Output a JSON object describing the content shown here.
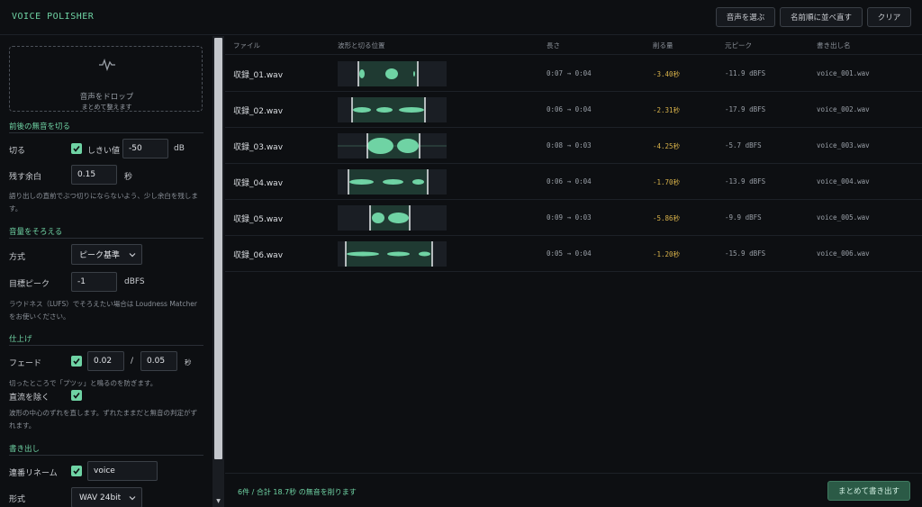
{
  "header": {
    "app_title": "VOICE POLISHER",
    "buttons": {
      "select_audio": "音声を選ぶ",
      "sort_rename": "名前順に並べ直す",
      "clear": "クリア"
    }
  },
  "sidebar": {
    "dropzone": {
      "main": "音声をドロップ",
      "sub": "まとめて整えます",
      "icon": "waveform-icon"
    },
    "trim": {
      "title": "前後の無音を切る",
      "cut_label": "切る",
      "threshold_checked": true,
      "threshold_label": "しきい値",
      "threshold_value": "-50",
      "threshold_unit": "dB",
      "margin_label": "残す余白",
      "margin_value": "0.15",
      "margin_unit": "秒",
      "help": "語り出しの直前でぶつ切りにならないよう、少し余白を残します。"
    },
    "volume": {
      "title": "音量をそろえる",
      "method_label": "方式",
      "method_value": "ピーク基準",
      "target_label": "目標ピーク",
      "target_value": "-1",
      "target_unit": "dBFS",
      "help": "ラウドネス（LUFS）でそろえたい場合は Loudness Matcher をお使いください。"
    },
    "finish": {
      "title": "仕上げ",
      "fade_label": "フェード",
      "fade_checked": true,
      "fade_in": "0.02",
      "fade_sep": "/",
      "fade_out": "0.05",
      "fade_unit": "秒",
      "fade_help": "切ったところで「プツッ」と鳴るのを防ぎます。",
      "dc_label": "直流を除く",
      "dc_checked": true,
      "dc_help": "波形の中心のずれを直します。ずれたままだと無音の判定がずれます。"
    },
    "export": {
      "title": "書き出し",
      "rename_label": "連番リネーム",
      "rename_checked": true,
      "rename_value": "voice",
      "format_label": "形式",
      "format_value": "WAV 24bit"
    }
  },
  "table": {
    "columns": [
      "ファイル",
      "波形と切る位置",
      "長さ",
      "削る量",
      "元ピーク",
      "書き出し名"
    ],
    "rows": [
      {
        "file": "収録_01.wav",
        "length": "0:07 → 0:04",
        "cut": "-3.40秒",
        "peak": "-11.9 dBFS",
        "output": "voice_001.wav"
      },
      {
        "file": "収録_02.wav",
        "length": "0:06 → 0:04",
        "cut": "-2.31秒",
        "peak": "-17.9 dBFS",
        "output": "voice_002.wav"
      },
      {
        "file": "収録_03.wav",
        "length": "0:08 → 0:03",
        "cut": "-4.25秒",
        "peak": "-5.7 dBFS",
        "output": "voice_003.wav"
      },
      {
        "file": "収録_04.wav",
        "length": "0:06 → 0:04",
        "cut": "-1.70秒",
        "peak": "-13.9 dBFS",
        "output": "voice_004.wav"
      },
      {
        "file": "収録_05.wav",
        "length": "0:09 → 0:03",
        "cut": "-5.86秒",
        "peak": "-9.9 dBFS",
        "output": "voice_005.wav"
      },
      {
        "file": "収録_06.wav",
        "length": "0:05 → 0:04",
        "cut": "-1.20秒",
        "peak": "-15.9 dBFS",
        "output": "voice_006.wav"
      }
    ]
  },
  "footer": {
    "summary": "6件 / 合計 18.7秒 の無音を削ります",
    "export_button": "まとめて書き出す"
  },
  "colors": {
    "accent": "#6fd3a4",
    "cut": "#d8b24a",
    "background": "#0d0f12"
  }
}
